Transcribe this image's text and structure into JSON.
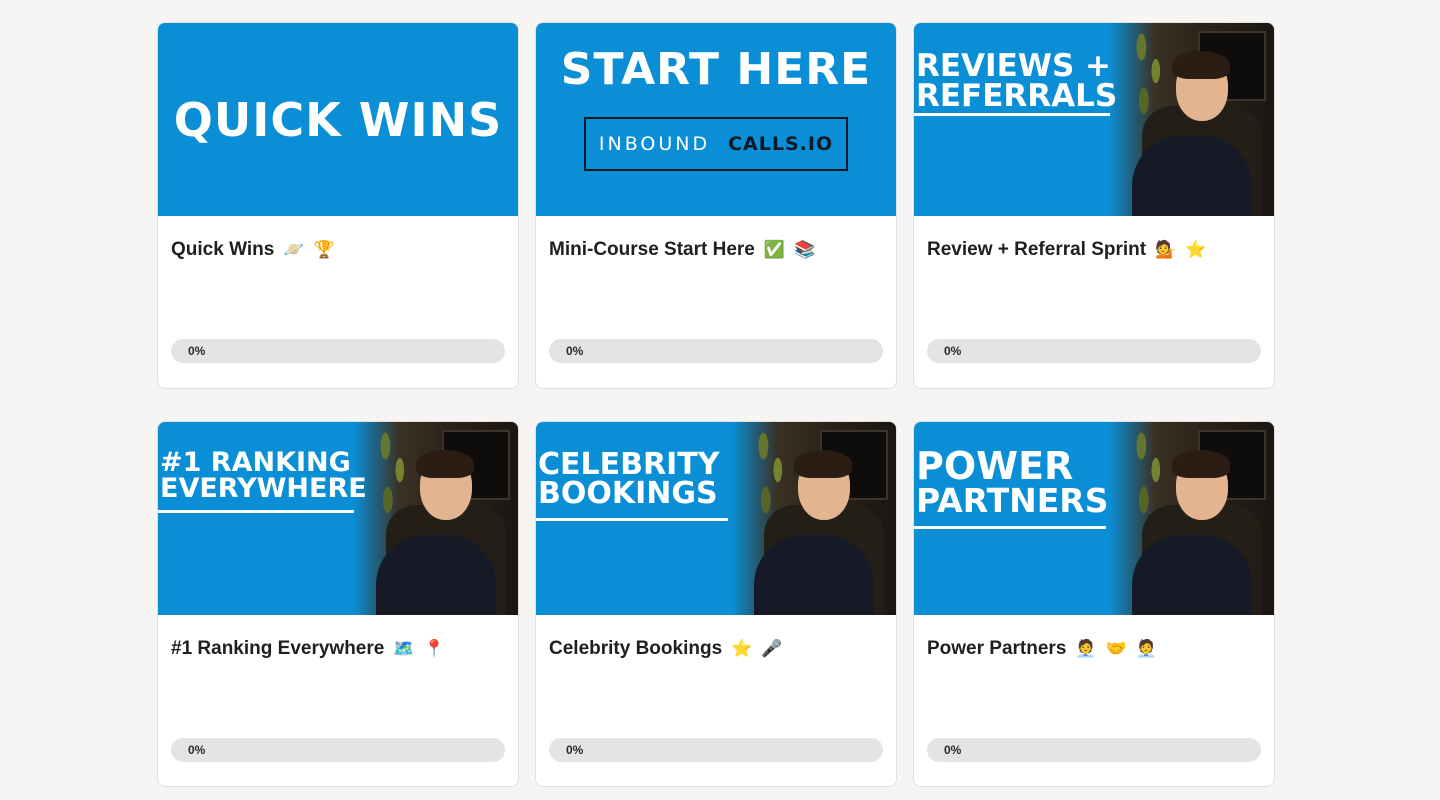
{
  "colors": {
    "thumb_blue": "#0a8fd6",
    "progress_track": "#e4e4e4"
  },
  "courses": [
    {
      "thumb_text": [
        "QUICK WINS"
      ],
      "title": "Quick Wins",
      "emojis": [
        "🪐",
        "🏆"
      ],
      "progress_label": "0%",
      "progress": 0
    },
    {
      "thumb_text": [
        "START HERE"
      ],
      "logo_left": "INBOUND",
      "logo_right": "CALLS.IO",
      "title": "Mini-Course Start Here",
      "emojis": [
        "✅",
        "📚"
      ],
      "progress_label": "0%",
      "progress": 0
    },
    {
      "thumb_text": [
        "REVIEWS +",
        "REFERRALS"
      ],
      "title": "Review + Referral Sprint",
      "emojis": [
        "💁",
        "⭐"
      ],
      "progress_label": "0%",
      "progress": 0
    },
    {
      "thumb_text": [
        "#1 RANKING",
        "EVERYWHERE"
      ],
      "title": "#1 Ranking Everywhere",
      "emojis": [
        "🗺️",
        "📍"
      ],
      "progress_label": "0%",
      "progress": 0
    },
    {
      "thumb_text": [
        "CELEBRITY",
        "BOOKINGS"
      ],
      "title": "Celebrity Bookings",
      "emojis": [
        "⭐",
        "🎤"
      ],
      "progress_label": "0%",
      "progress": 0
    },
    {
      "thumb_text": [
        "POWER",
        "PARTNERS"
      ],
      "title": "Power Partners",
      "emojis": [
        "🧑‍💼",
        "🤝",
        "🧑‍💼"
      ],
      "progress_label": "0%",
      "progress": 0
    }
  ]
}
